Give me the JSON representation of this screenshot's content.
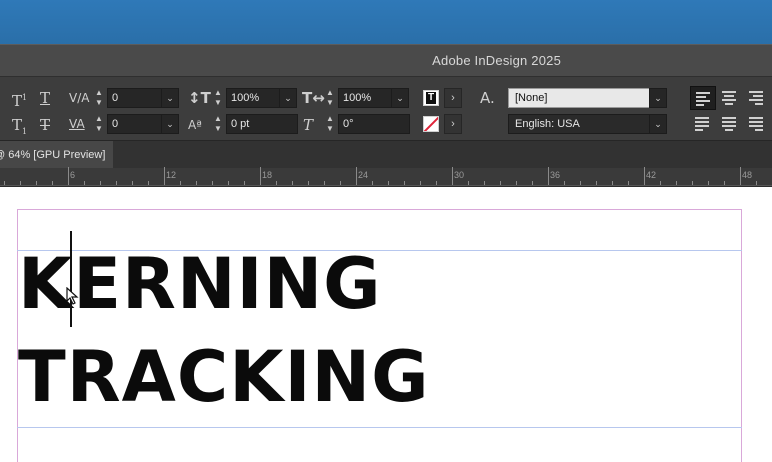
{
  "window": {
    "title": "Adobe InDesign 2025"
  },
  "control_panel": {
    "kerning_value": "0",
    "tracking_value": "0",
    "vertical_scale": "100%",
    "horizontal_scale": "100%",
    "baseline_shift": "0 pt",
    "skew": "0°",
    "character_style": "[None]",
    "language": "English: USA"
  },
  "document_tab": {
    "label": "@ 64% [GPU Preview]"
  },
  "ruler": {
    "ticks": [
      "6",
      "12",
      "18",
      "24",
      "30",
      "36",
      "42",
      "48"
    ]
  },
  "canvas": {
    "line1": "KERNING",
    "line2": "TRACKING"
  },
  "colors": {
    "desktop": "#2a6fa9",
    "chrome": "#3d3d3d",
    "page_border": "#d9a8d9",
    "margin_guide": "#b7c7ee"
  }
}
